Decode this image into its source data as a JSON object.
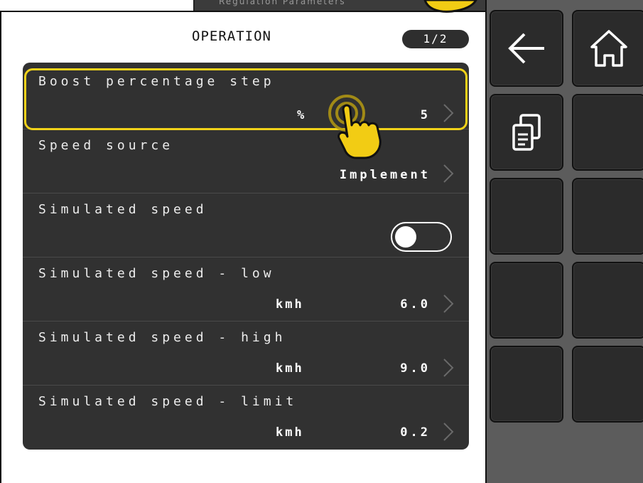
{
  "background_window": {
    "title": "Regulation Parameters"
  },
  "header": {
    "title": "OPERATION",
    "page_indicator": "1/2"
  },
  "rows": [
    {
      "label": "Boost percentage step",
      "unit": "%",
      "value": "5",
      "selected": true
    },
    {
      "label": "Speed source",
      "value": "Implement"
    },
    {
      "label": "Simulated speed",
      "toggle_on": false
    },
    {
      "label": "Simulated speed - low",
      "unit": "kmh",
      "value": "6.0"
    },
    {
      "label": "Simulated speed - high",
      "unit": "kmh",
      "value": "9.0"
    },
    {
      "label": "Simulated speed - limit",
      "unit": "kmh",
      "value": "0.2"
    }
  ],
  "side_buttons": [
    {
      "icon": "back-arrow-icon"
    },
    {
      "icon": "home-icon"
    },
    {
      "icon": "copy-icon"
    },
    {
      "icon": ""
    },
    {
      "icon": ""
    },
    {
      "icon": ""
    },
    {
      "icon": ""
    },
    {
      "icon": ""
    },
    {
      "icon": ""
    },
    {
      "icon": ""
    }
  ],
  "colors": {
    "highlight": "#f1d21a",
    "panel": "#313131",
    "hand": "#f2cc14"
  }
}
